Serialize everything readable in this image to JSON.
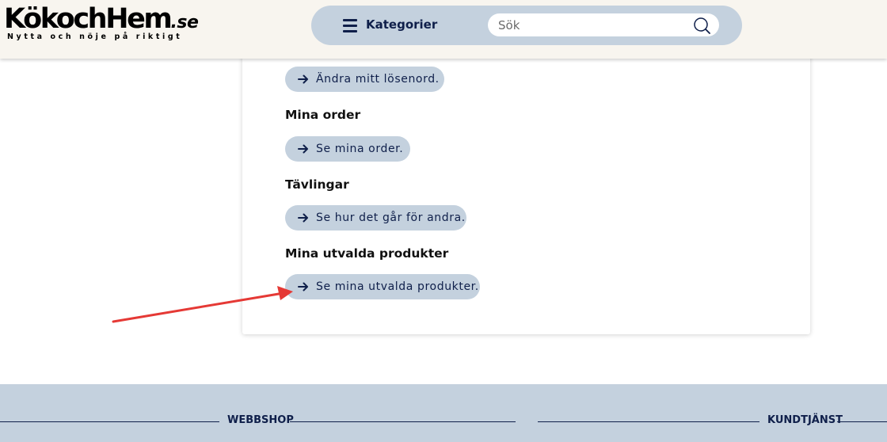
{
  "header": {
    "logo_text": "KökochHem",
    "logo_suffix": ".se",
    "logo_tagline": "Nytta och nöje på riktigt",
    "nav_menu_label": "Kategorier",
    "search_placeholder": "Sök",
    "search_value": ""
  },
  "account": {
    "password_button": "Ändra mitt lösenord.",
    "orders_title": "Mina order",
    "orders_button": "Se mina order.",
    "competitions_title": "Tävlingar",
    "competitions_button": "Se hur det går för andra.",
    "products_title": "Mina utvalda produkter",
    "products_button": "Se mina utvalda produkter."
  },
  "footer": {
    "webshop_heading": "WEBBSHOP",
    "service_heading": "KUNDTJÄNST"
  },
  "colors": {
    "header_bg": "#f8f5ef",
    "pill_bg": "#c4d1de",
    "navy": "#0f1f4a",
    "annotation_red": "#e53935"
  }
}
